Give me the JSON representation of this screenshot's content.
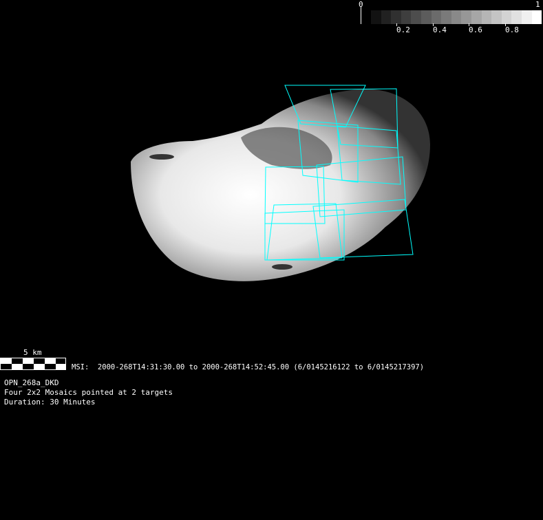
{
  "colorbar": {
    "min_label": "0",
    "max_label": "1",
    "ticks": [
      "0.2",
      "0.4",
      "0.6",
      "0.8"
    ],
    "steps": 17
  },
  "scale_bar": {
    "label": "5 km"
  },
  "msi_line": "MSI:  2000-268T14:31:30.00 to 2000-268T14:52:45.00 (6/0145216122 to 6/0145217397)",
  "info": {
    "name": "OPN_268a_DKD",
    "description": "Four 2x2 Mosaics pointed at 2 targets",
    "duration": "Duration: 30 Minutes"
  },
  "colors": {
    "footprint": "#00ffff",
    "background": "#000000"
  }
}
